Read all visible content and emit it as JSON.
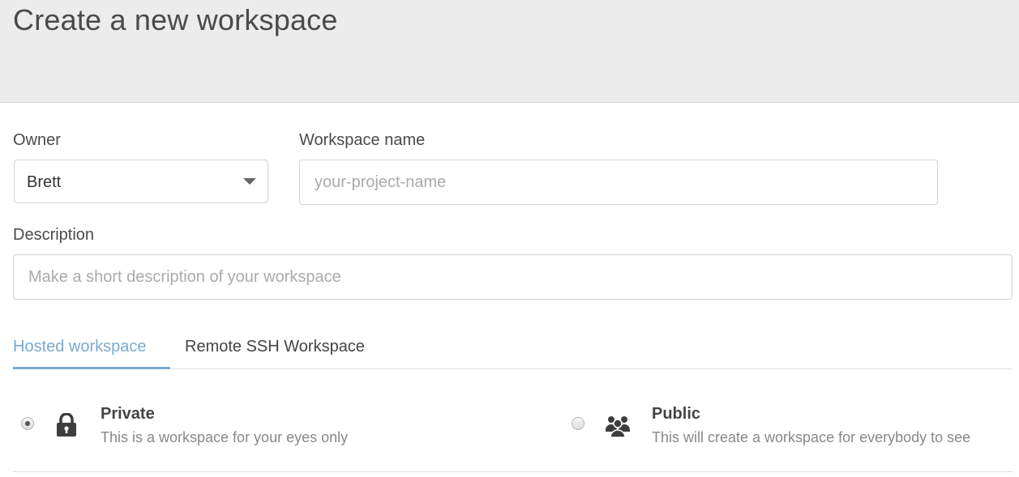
{
  "page": {
    "title": "Create a new workspace"
  },
  "owner": {
    "label": "Owner",
    "selected": "Brett"
  },
  "workspace_name": {
    "label": "Workspace name",
    "value": "",
    "placeholder": "your-project-name"
  },
  "description": {
    "label": "Description",
    "value": "",
    "placeholder": "Make a short description of your workspace"
  },
  "tabs": [
    {
      "label": "Hosted workspace",
      "active": true
    },
    {
      "label": "Remote SSH Workspace",
      "active": false
    }
  ],
  "visibility": {
    "private": {
      "title": "Private",
      "description": "This is a workspace for your eyes only",
      "selected": true,
      "icon": "lock-icon"
    },
    "public": {
      "title": "Public",
      "description": "This will create a workspace for everybody to see",
      "selected": false,
      "icon": "users-icon"
    }
  },
  "colors": {
    "header_bg": "#ececec",
    "accent": "#7aaad1"
  }
}
